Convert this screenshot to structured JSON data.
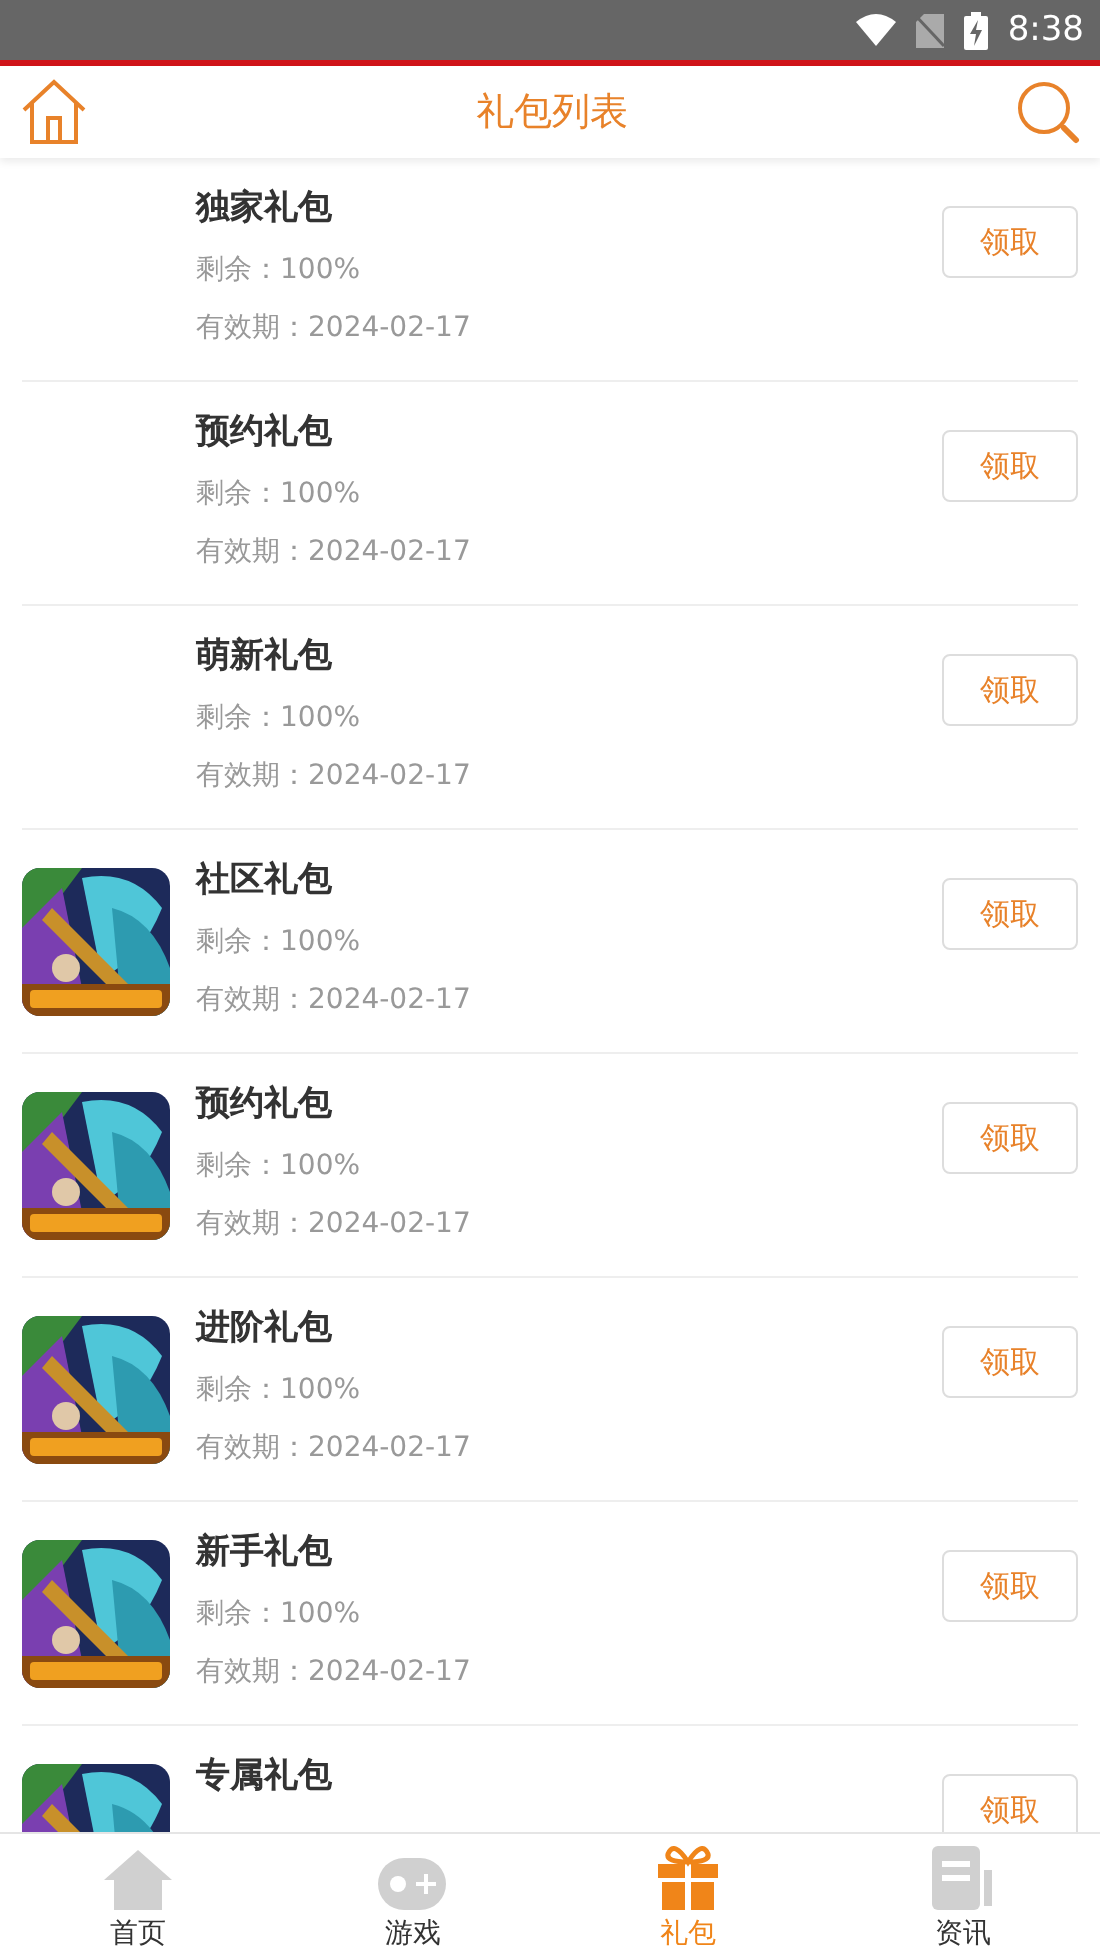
{
  "status_bar": {
    "time": "8:38"
  },
  "header": {
    "title": "礼包列表"
  },
  "gifts": [
    {
      "title": "独家礼包",
      "remaining": "剩余：100%",
      "expiry": "有效期：2024-02-17",
      "button": "领取",
      "has_picture": false
    },
    {
      "title": "预约礼包",
      "remaining": "剩余：100%",
      "expiry": "有效期：2024-02-17",
      "button": "领取",
      "has_picture": false
    },
    {
      "title": "萌新礼包",
      "remaining": "剩余：100%",
      "expiry": "有效期：2024-02-17",
      "button": "领取",
      "has_picture": false
    },
    {
      "title": "社区礼包",
      "remaining": "剩余：100%",
      "expiry": "有效期：2024-02-17",
      "button": "领取",
      "has_picture": true
    },
    {
      "title": "预约礼包",
      "remaining": "剩余：100%",
      "expiry": "有效期：2024-02-17",
      "button": "领取",
      "has_picture": true
    },
    {
      "title": "进阶礼包",
      "remaining": "剩余：100%",
      "expiry": "有效期：2024-02-17",
      "button": "领取",
      "has_picture": true
    },
    {
      "title": "新手礼包",
      "remaining": "剩余：100%",
      "expiry": "有效期：2024-02-17",
      "button": "领取",
      "has_picture": true
    },
    {
      "title": "专属礼包",
      "button": "领取",
      "has_picture": true
    }
  ],
  "tab_bar": [
    {
      "label": "首页",
      "kind": "home",
      "selected": false
    },
    {
      "label": "游戏",
      "kind": "gamepad",
      "selected": false
    },
    {
      "label": "礼包",
      "kind": "gift",
      "selected": true
    },
    {
      "label": "资讯",
      "kind": "news",
      "selected": false
    }
  ]
}
